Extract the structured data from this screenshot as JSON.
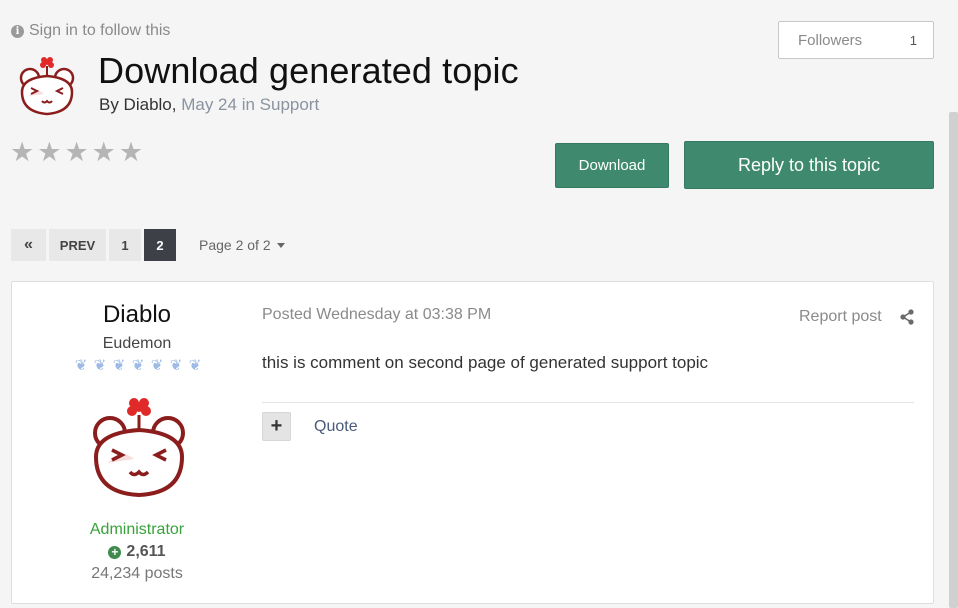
{
  "header": {
    "signin_text": "Sign in to follow this",
    "followers_label": "Followers",
    "followers_count": "1",
    "title": "Download generated topic",
    "by_prefix": "By Diablo,",
    "date_text": "May 24 in Support"
  },
  "rating": {
    "stars_filled": 0,
    "stars_total": 5
  },
  "actions": {
    "download_label": "Download",
    "reply_label": "Reply to this topic"
  },
  "pagination": {
    "first_icon": "«",
    "prev_label": "PREV",
    "pages": [
      "1",
      "2"
    ],
    "current_page": "2",
    "page_label": "Page 2 of 2"
  },
  "post": {
    "author": {
      "name": "Diablo",
      "rank": "Eudemon",
      "group": "Administrator",
      "reputation": "2,611",
      "posts": "24,234 posts"
    },
    "posted_text": "Posted Wednesday at 03:38 PM",
    "report_label": "Report post",
    "content": "this is comment on second page of generated support topic",
    "quote_label": "Quote"
  },
  "colors": {
    "accent_green": "#3f8a6f",
    "group_green": "#37a33a",
    "active_page": "#3d4147"
  },
  "icons": [
    "info-icon",
    "star-icon",
    "double-chevron-left-icon",
    "caret-down-icon",
    "rank-pip-icon",
    "plus-circle-icon",
    "share-icon",
    "plus-icon"
  ]
}
